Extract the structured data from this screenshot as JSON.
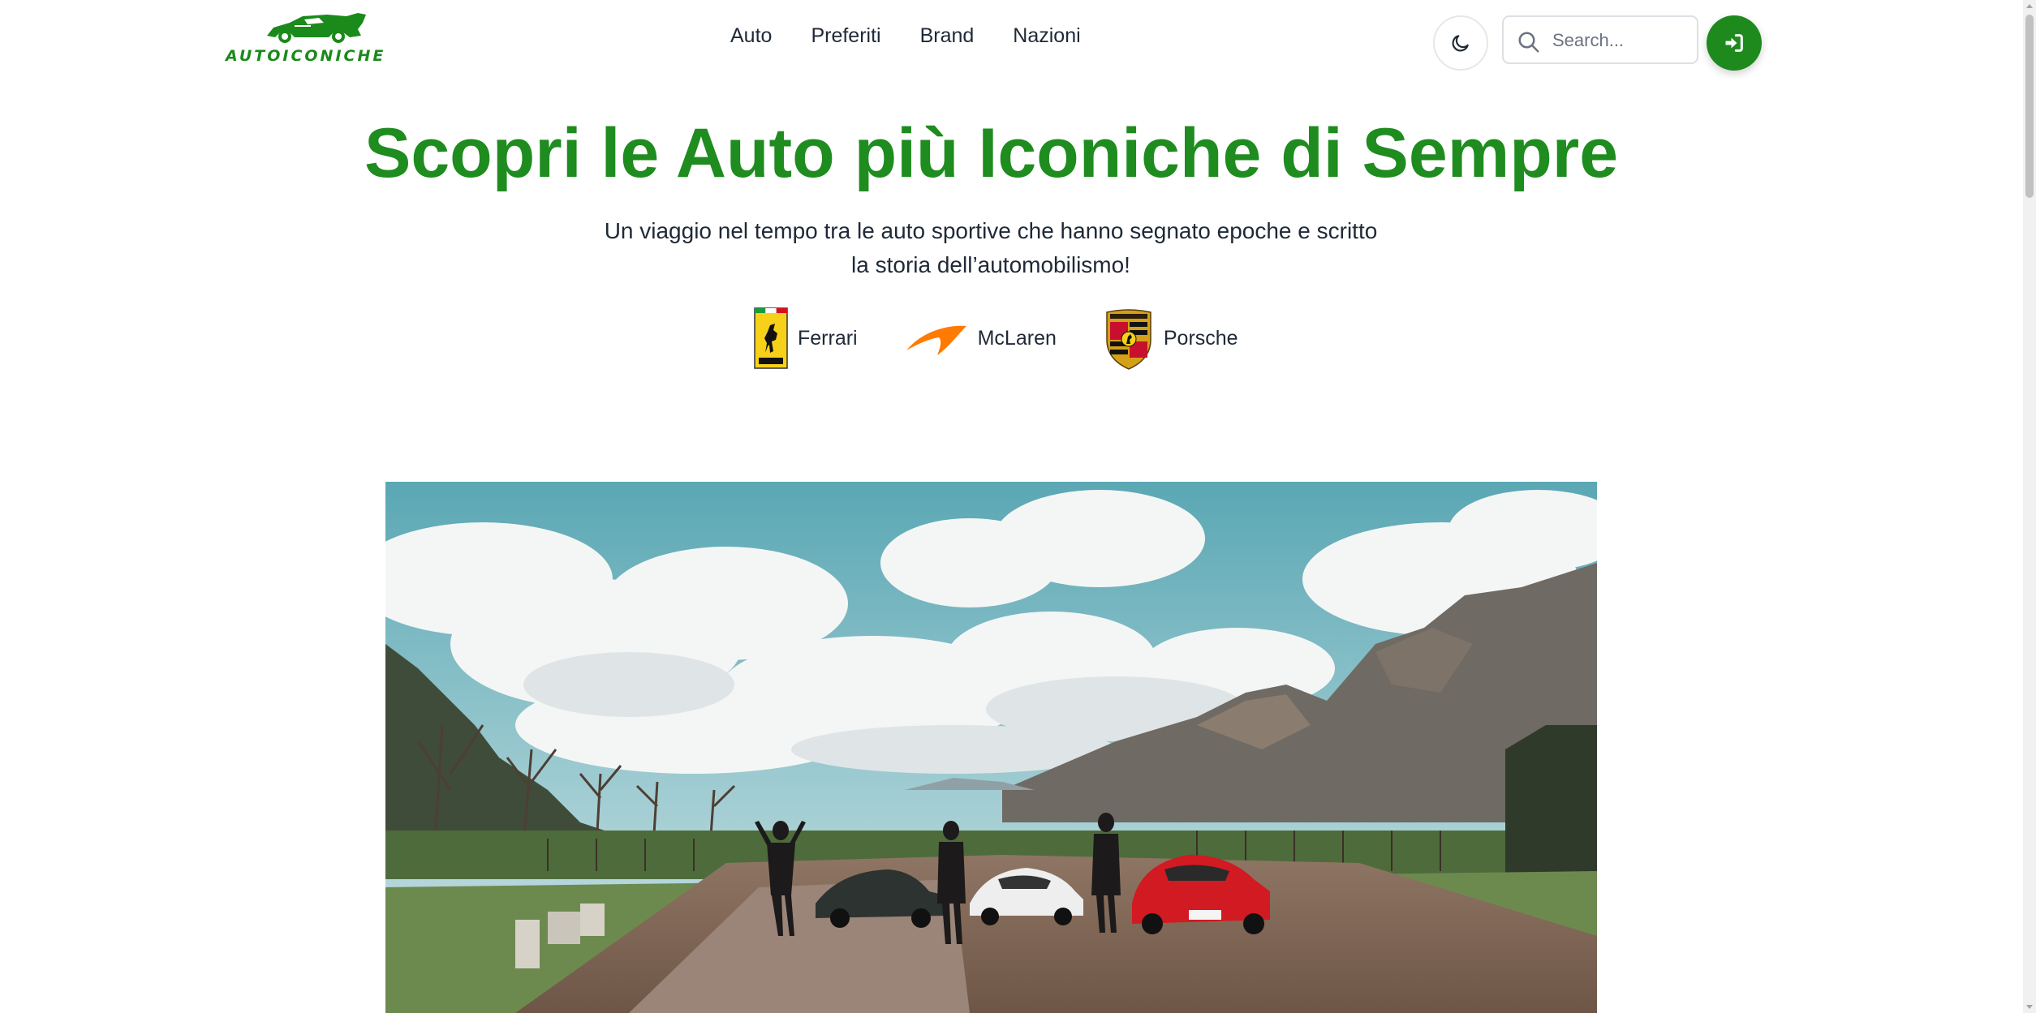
{
  "header": {
    "logo_text": "AUTOICONICHE",
    "nav": [
      {
        "label": "Auto"
      },
      {
        "label": "Preferiti"
      },
      {
        "label": "Brand"
      },
      {
        "label": "Nazioni"
      }
    ],
    "theme_icon": "moon-icon",
    "search": {
      "placeholder": "Search...",
      "value": ""
    },
    "login_icon": "sign-in-icon"
  },
  "hero": {
    "title": "Scopri le Auto più Iconiche di Sempre",
    "subtitle_line1": "Un viaggio nel tempo tra le auto sportive che hanno segnato epoche e scritto",
    "subtitle_line2": "la storia dell’automobilismo!",
    "brands": [
      {
        "label": "Ferrari",
        "icon": "ferrari-logo"
      },
      {
        "label": "McLaren",
        "icon": "mclaren-logo"
      },
      {
        "label": "Porsche",
        "icon": "porsche-logo"
      }
    ],
    "photo": "three-sports-cars-landscape"
  },
  "colors": {
    "brand_green": "#1e8c1e",
    "text": "#1f2937",
    "mclaren_orange": "#ff7a00",
    "ferrari_yellow": "#f7d117",
    "ferrari_red": "#d6111e"
  }
}
